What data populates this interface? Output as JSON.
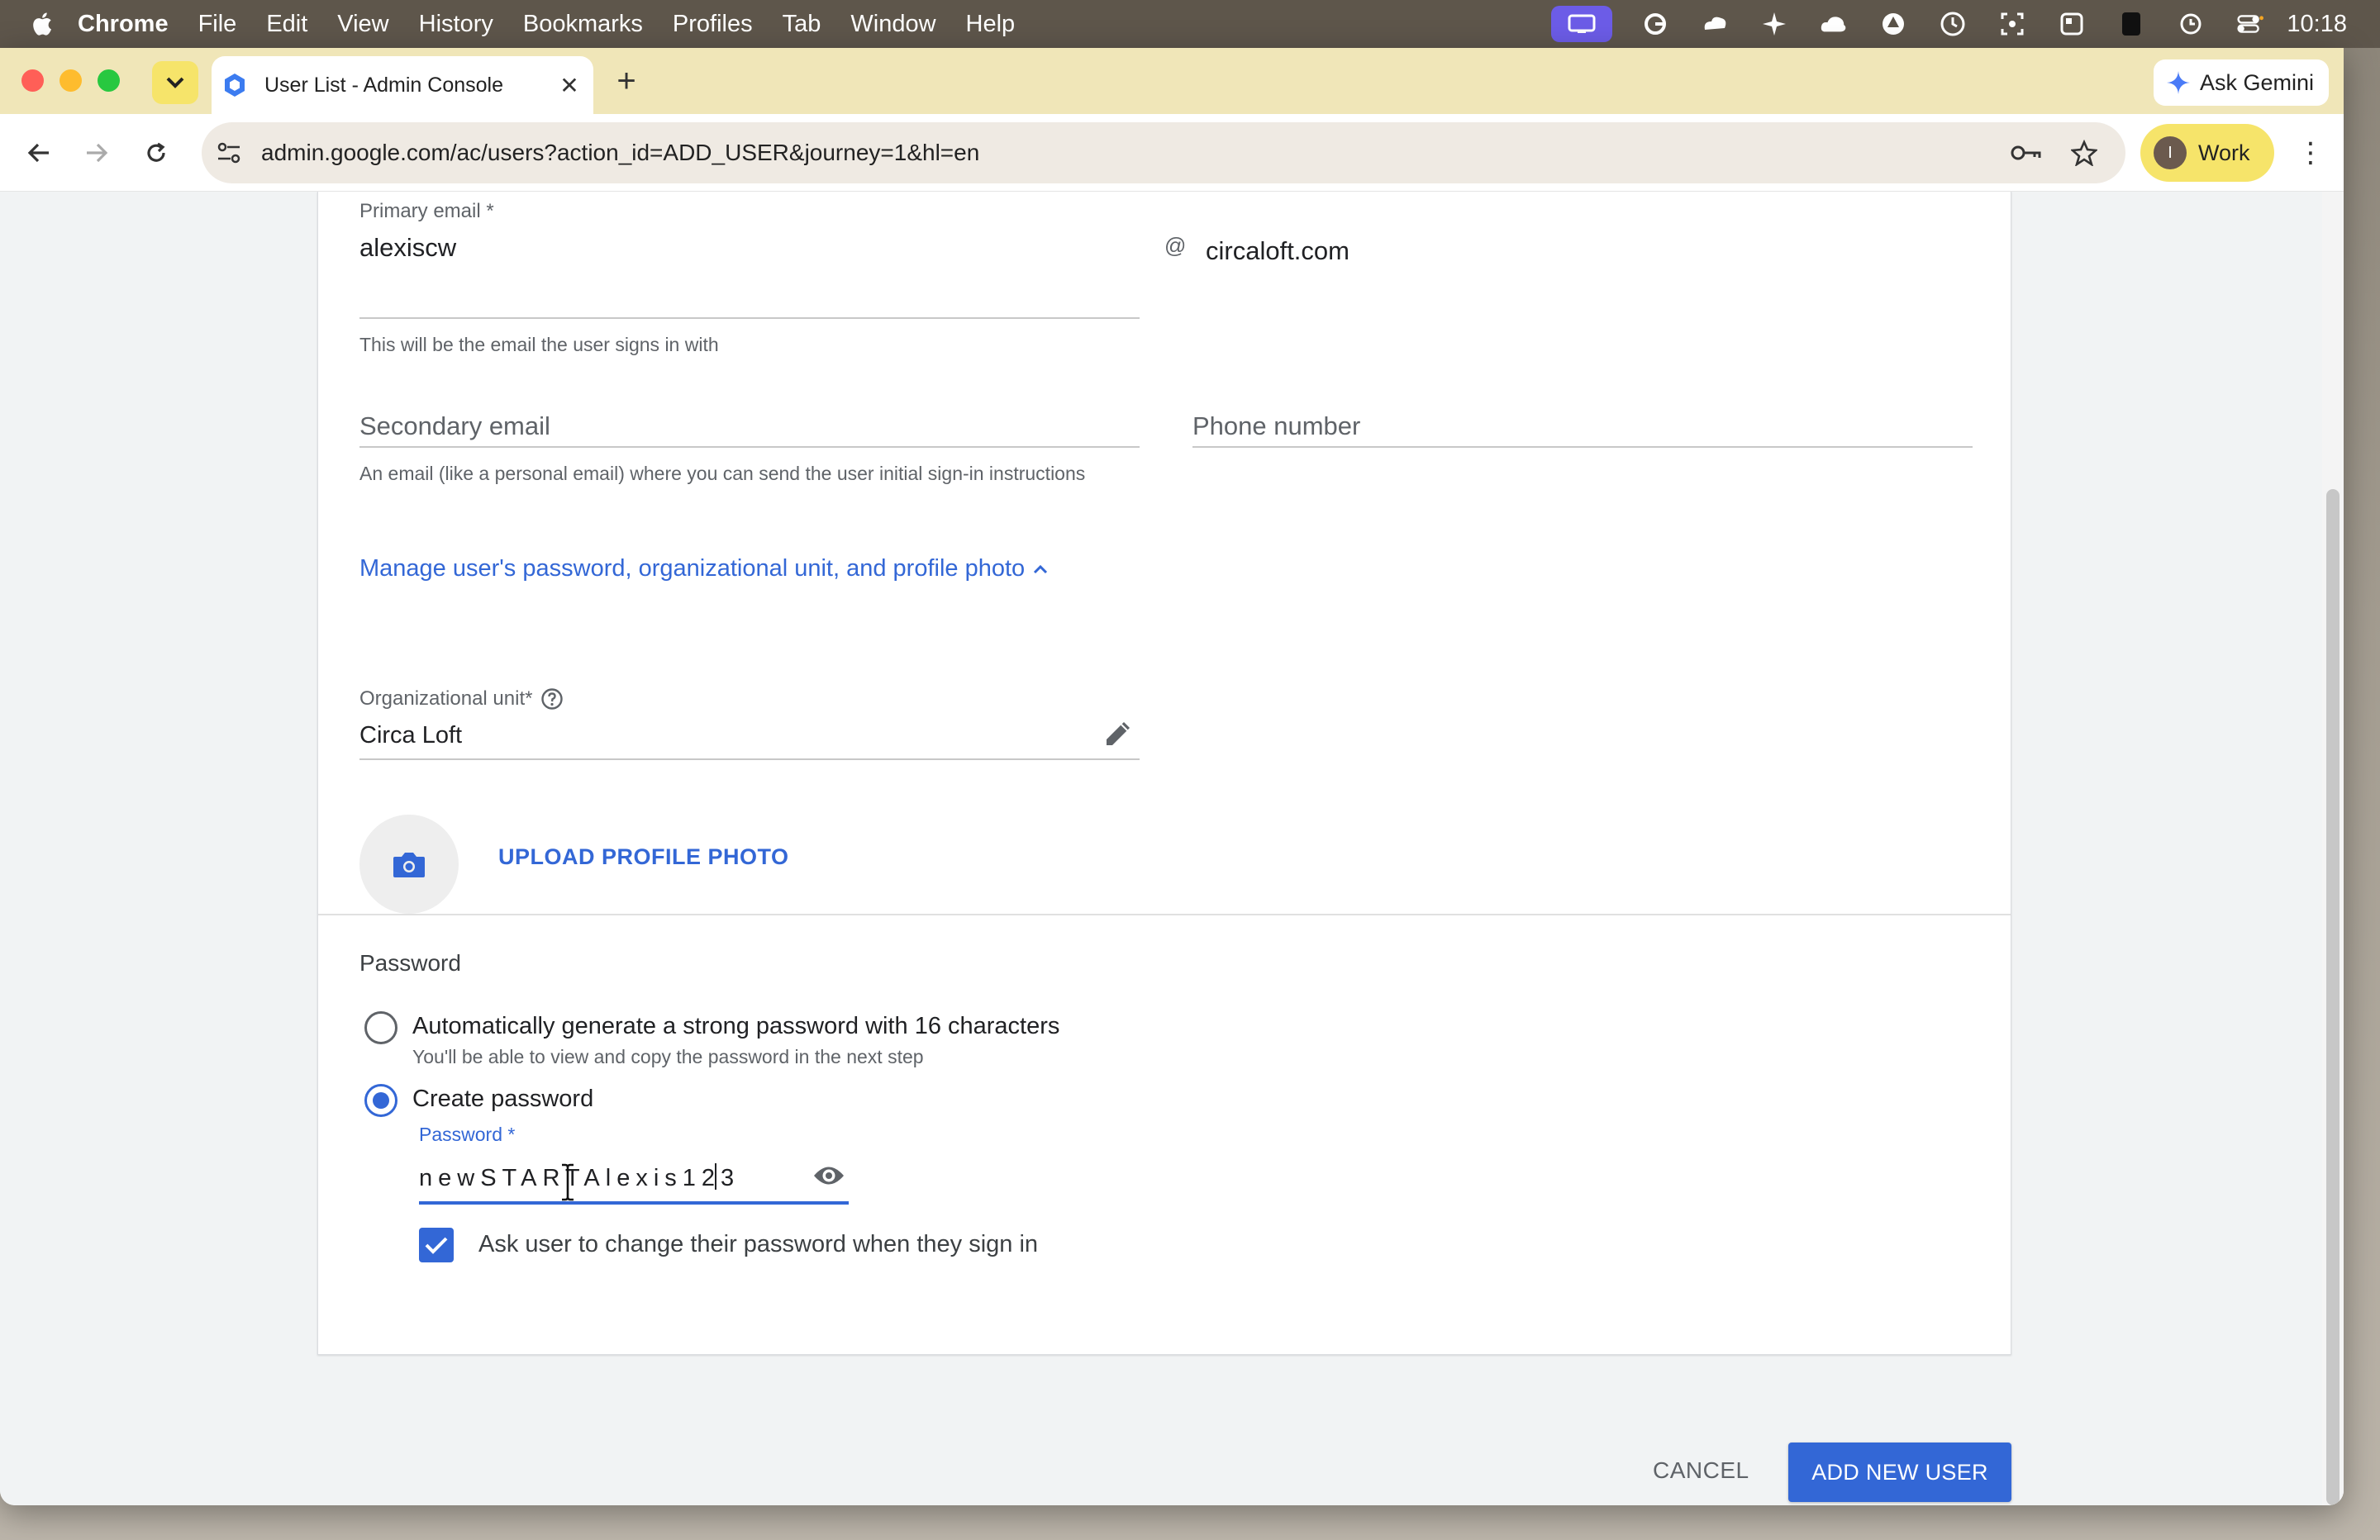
{
  "menubar": {
    "app_name": "Chrome",
    "items": [
      "File",
      "Edit",
      "View",
      "History",
      "Bookmarks",
      "Profiles",
      "Tab",
      "Window",
      "Help"
    ],
    "clock": "10:18"
  },
  "browser": {
    "tab_title": "User List - Admin Console",
    "url": "admin.google.com/ac/users?action_id=ADD_USER&journey=1&hl=en",
    "gemini_label": "Ask Gemini",
    "profile_label": "Work",
    "profile_initial": "I"
  },
  "form": {
    "primary_email_label": "Primary email *",
    "primary_email_value": "alexiscw",
    "at_sign": "@",
    "domain": "circaloft.com",
    "primary_email_helper": "This will be the email the user signs in with",
    "secondary_email_placeholder": "Secondary email",
    "secondary_email_helper": "An email (like a personal email) where you can send the user initial sign-in instructions",
    "phone_placeholder": "Phone number",
    "manage_link": "Manage user's password, organizational unit, and profile photo",
    "org_unit_label": "Organizational unit*",
    "org_unit_value": "Circa Loft",
    "upload_photo": "UPLOAD PROFILE PHOTO",
    "password_section_title": "Password",
    "option_auto_label": "Automatically generate a strong password with 16 characters",
    "option_auto_helper": "You'll be able to view and copy the password in the next step",
    "option_create_label": "Create password",
    "password_label": "Password *",
    "password_value": "newSTARTAlexis123",
    "change_on_signin_label": "Ask user to change their password when they sign in",
    "change_on_signin_checked": true,
    "selected_option": "create"
  },
  "actions": {
    "cancel": "CANCEL",
    "add_user": "ADD NEW USER"
  },
  "colors": {
    "accent": "#3367d6",
    "tabbar": "#f0e6b8",
    "profile_chip": "#f6e46a"
  }
}
